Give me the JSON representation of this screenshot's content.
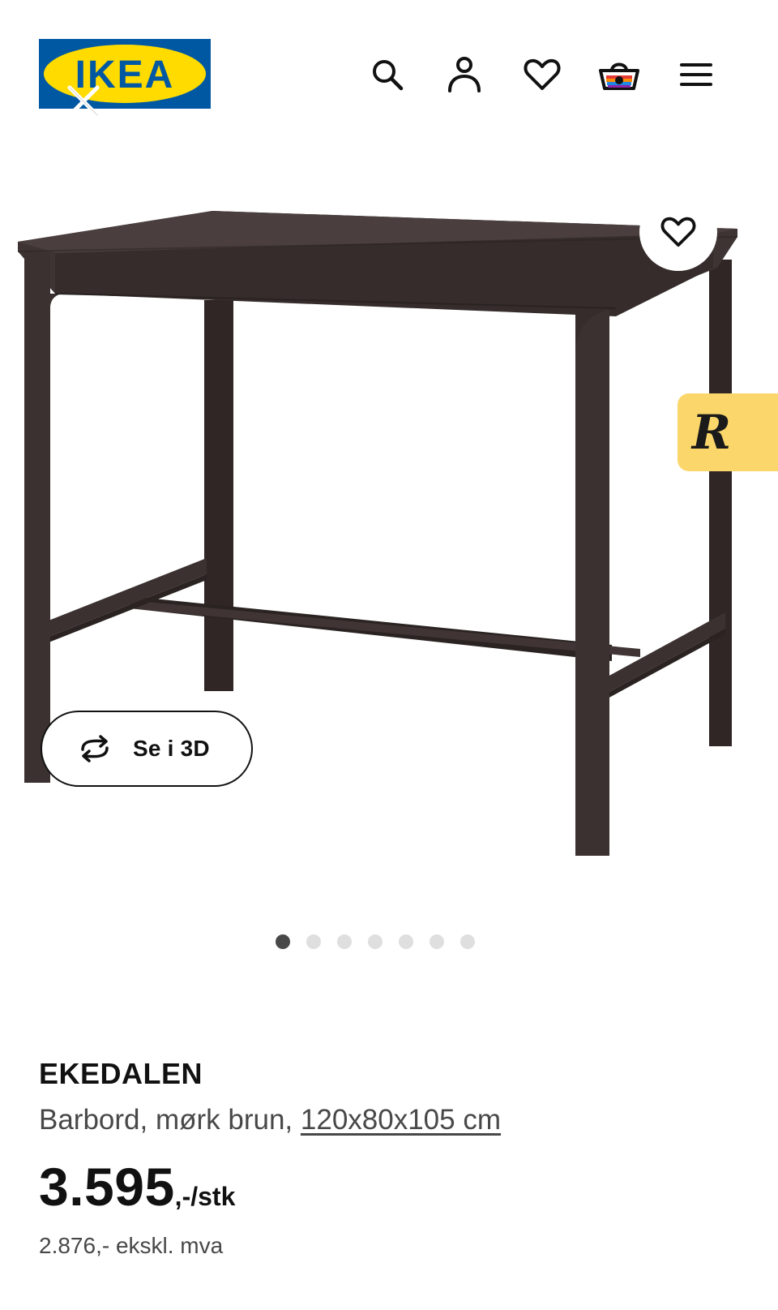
{
  "header": {
    "logo_text": "IKEA",
    "icons": {
      "search": "search-icon",
      "account": "account-icon",
      "favourites": "heart-icon",
      "cart": "basket-icon",
      "menu": "menu-icon"
    },
    "logo_close_icon": "close-icon"
  },
  "gallery": {
    "favourite_icon": "heart-icon",
    "side_tab_letter": "R",
    "view_3d_label": "Se i 3D",
    "slide_count": 7,
    "active_slide": 1
  },
  "product": {
    "name": "EKEDALEN",
    "description": "Barbord, mørk brun, ",
    "dimensions": "120x80x105 cm",
    "price_main": "3.595",
    "price_suffix": ",-/stk",
    "price_ex_vat": "2.876,- ekskl. mva"
  },
  "colors": {
    "ikea_blue": "#0058a3",
    "ikea_yellow": "#ffdb00",
    "table_brown": "#3b3130",
    "tab_yellow": "#fbd66a"
  }
}
